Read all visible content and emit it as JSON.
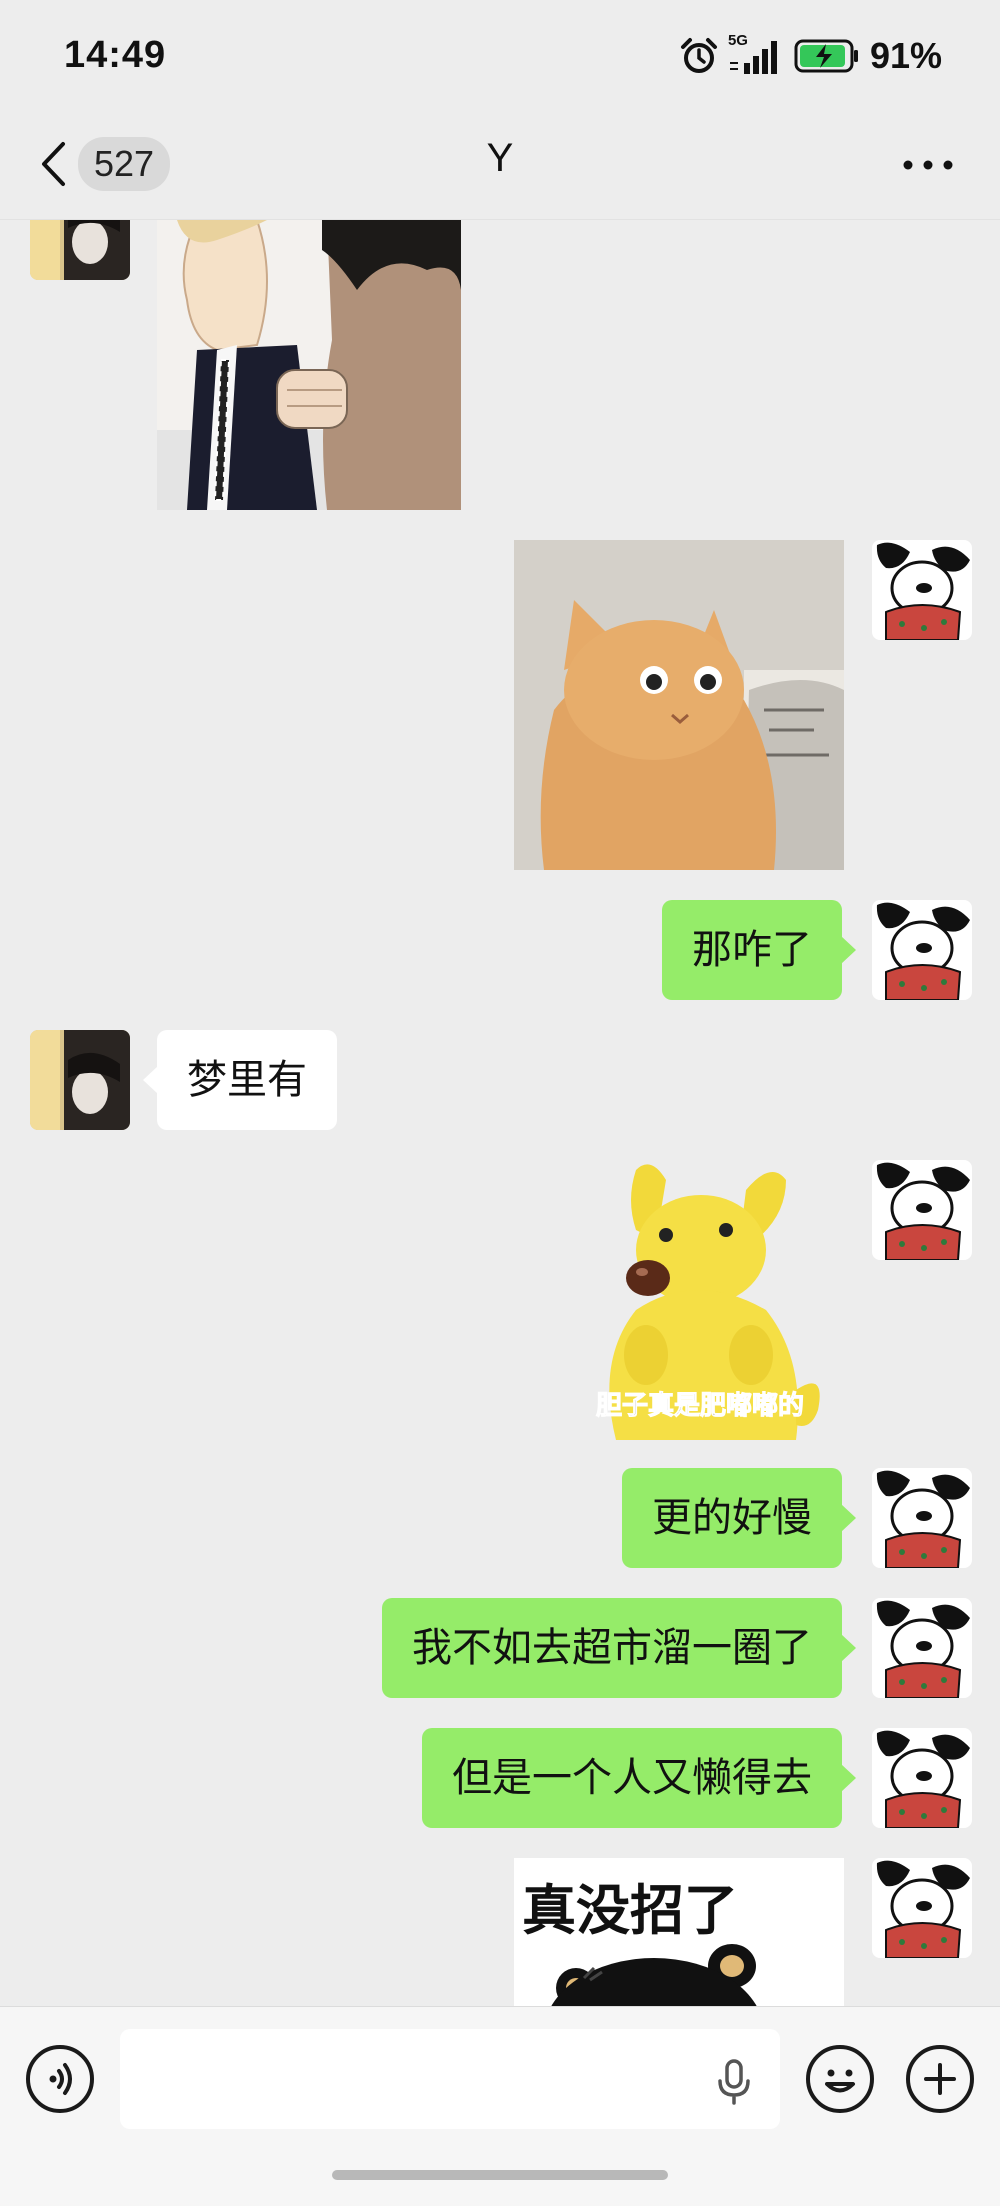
{
  "status_bar": {
    "time": "14:49",
    "network": "5G",
    "battery_percent": "91%",
    "icons": [
      "alarm-icon",
      "signal-icon",
      "battery-charging-icon"
    ]
  },
  "header": {
    "unread_count": "527",
    "title": "Y",
    "icons": [
      "chevron-left-icon",
      "more-icon"
    ]
  },
  "messages": [
    {
      "side": "other",
      "kind": "sticker",
      "depicts": "two cartoon men bumping fists"
    },
    {
      "side": "self",
      "kind": "sticker",
      "depicts": "orange cat with googly eyes"
    },
    {
      "side": "self",
      "kind": "text",
      "text": "那咋了"
    },
    {
      "side": "other",
      "kind": "text",
      "text": "梦里有"
    },
    {
      "side": "self",
      "kind": "sticker",
      "depicts": "yellow cartoon dog",
      "caption": "胆子真是肥嘟嘟的"
    },
    {
      "side": "self",
      "kind": "text",
      "text": "更的好慢"
    },
    {
      "side": "self",
      "kind": "text",
      "text": "我不如去超市溜一圈了"
    },
    {
      "side": "self",
      "kind": "text",
      "text": "但是一个人又懒得去"
    },
    {
      "side": "self",
      "kind": "sticker",
      "depicts": "black cartoon bear",
      "caption": "真没招了"
    }
  ],
  "input_bar": {
    "value": "",
    "placeholder": "",
    "icons": [
      "voice-icon",
      "microphone-icon",
      "emoji-icon",
      "plus-icon"
    ]
  },
  "colors": {
    "background": "#ededed",
    "self_bubble": "#95ec69",
    "other_bubble": "#ffffff",
    "input_bar": "#f6f6f6"
  }
}
